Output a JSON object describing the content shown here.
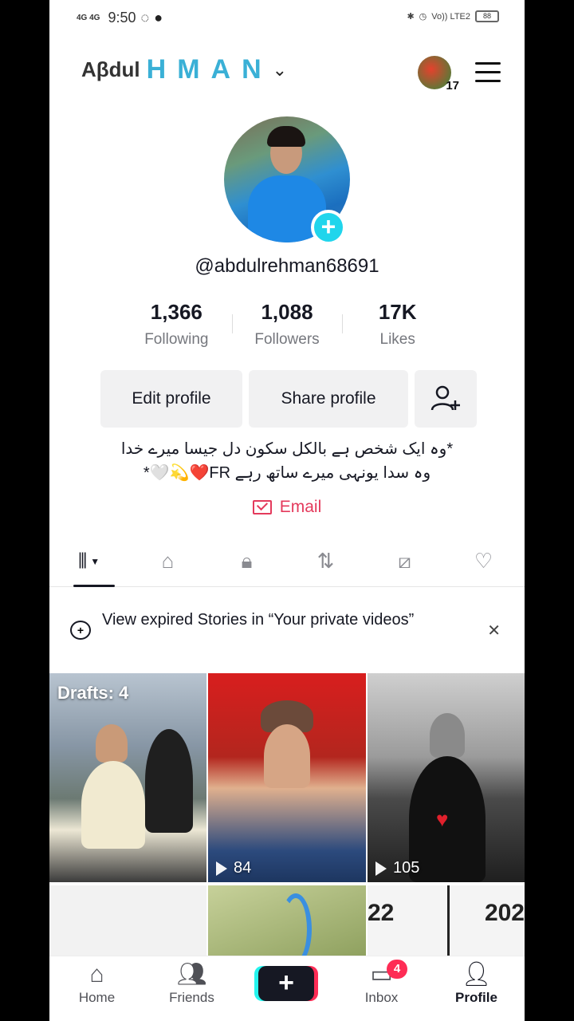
{
  "status_bar": {
    "network": "4G 4G",
    "time": "9:50",
    "volte": "Vo)) LTE2",
    "battery": "88"
  },
  "header": {
    "title_text": "HMAN",
    "title_prefix": "Aβdul",
    "badge_number": "17"
  },
  "profile": {
    "handle": "@abdulrehman68691",
    "stats": [
      {
        "value": "1,366",
        "label": "Following"
      },
      {
        "value": "1,088",
        "label": "Followers"
      },
      {
        "value": "17K",
        "label": "Likes"
      }
    ],
    "edit_button": "Edit profile",
    "share_button": "Share profile",
    "bio_line1": "*وہ ایک شخص ہے بالکل سکون دل جیسا میرے خدا",
    "bio_line2": "وہ سدا یونہی میرے ساتھ رہے FR❤️💫🤍*",
    "email_label": "Email"
  },
  "banner": {
    "text": "View expired Stories in “Your private videos”",
    "close": "✕"
  },
  "grid": {
    "drafts_label": "Drafts: 4",
    "views": [
      "84",
      "105"
    ],
    "cell6_left": "22",
    "cell6_right": "202"
  },
  "bottom_nav": [
    {
      "label": "Home"
    },
    {
      "label": "Friends"
    },
    {
      "label": ""
    },
    {
      "label": "Inbox",
      "badge": "4"
    },
    {
      "label": "Profile"
    }
  ],
  "colors": {
    "accent_cyan": "#20d5ec",
    "email_red": "#e43a5c",
    "badge_red": "#fe2c55"
  }
}
